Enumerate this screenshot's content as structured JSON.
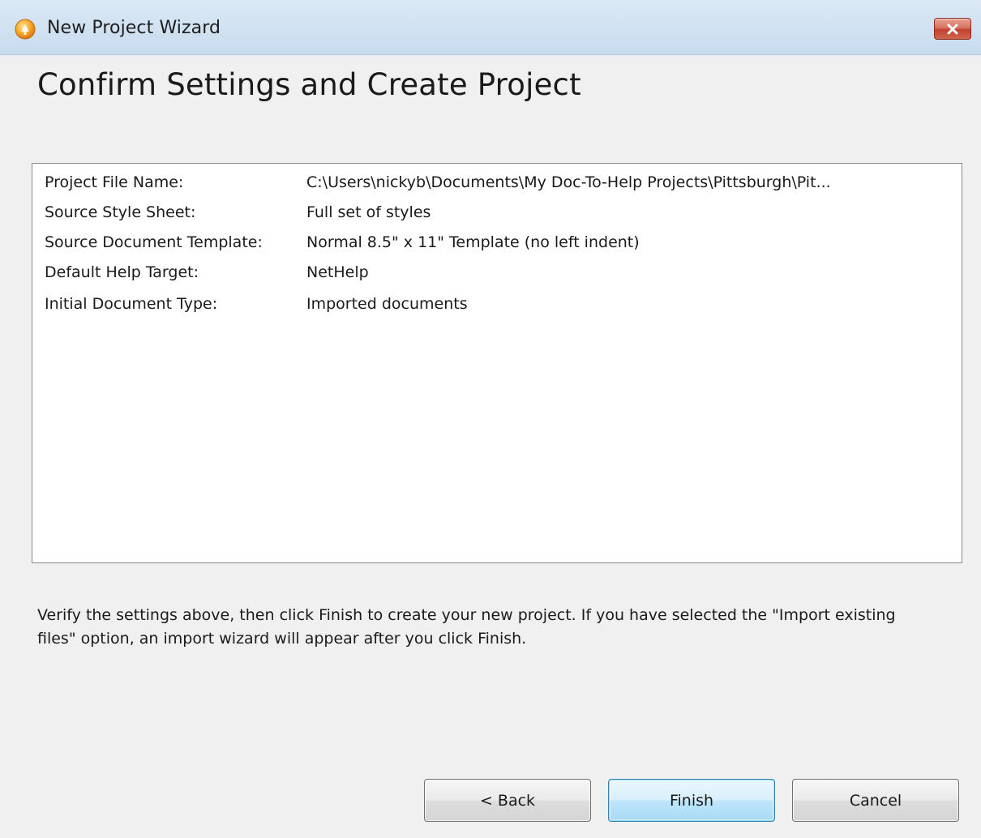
{
  "window": {
    "title": "New Project Wizard"
  },
  "heading": "Confirm Settings and Create Project",
  "settings": [
    {
      "label": "Project File Name:",
      "value": "C:\\Users\\nickyb\\Documents\\My Doc-To-Help Projects\\Pittsburgh\\Pit..."
    },
    {
      "label": "Source Style Sheet:",
      "value": "Full set of styles"
    },
    {
      "label": "Source Document Template:",
      "value": "Normal 8.5\" x 11\" Template (no left indent)"
    },
    {
      "label": "Default Help Target:",
      "value": "NetHelp"
    },
    {
      "label": "Initial Document Type:",
      "value": "Imported documents"
    }
  ],
  "description": "Verify the settings above, then click Finish to create your new project. If you have selected the \"Import existing files\" option, an import wizard will appear after you click Finish.",
  "buttons": {
    "back": "< Back",
    "finish": "Finish",
    "cancel": "Cancel"
  },
  "icons": {
    "app": "doc-to-help-app-icon",
    "close": "close-icon"
  },
  "colors": {
    "titlebar": "#d0e1f1",
    "close_button": "#c2412d",
    "default_button_border": "#3c7fb1"
  }
}
